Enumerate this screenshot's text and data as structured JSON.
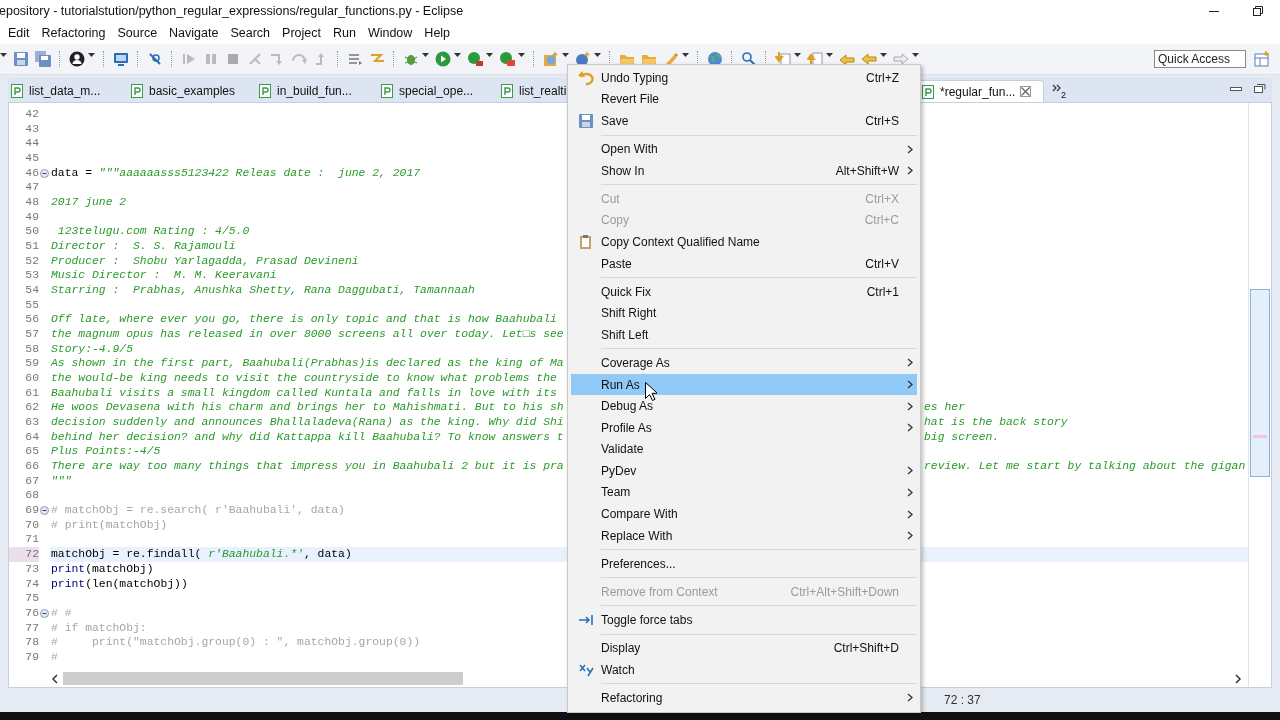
{
  "window": {
    "title": "epository - tutorialstution/python_regular_expressions/regular_functions.py - Eclipse"
  },
  "menu_bar": [
    "Edit",
    "Refactoring",
    "Source",
    "Navigate",
    "Search",
    "Project",
    "Run",
    "Window",
    "Help"
  ],
  "quick_access": {
    "placeholder": "Quick Access"
  },
  "tabs": [
    {
      "label": "list_data_m...",
      "selected": false
    },
    {
      "label": "basic_examples",
      "selected": false
    },
    {
      "label": "in_build_fun...",
      "selected": false
    },
    {
      "label": "special_ope...",
      "selected": false
    },
    {
      "label": "list_realti",
      "selected": false
    },
    {
      "label": "*regular_fun...",
      "selected": true
    }
  ],
  "tabs_overflow": "2",
  "editor": {
    "lines": [
      {
        "number": "42",
        "fold": false,
        "current": false
      },
      {
        "number": "43",
        "fold": false,
        "current": false
      },
      {
        "number": "44",
        "fold": false,
        "current": false
      },
      {
        "number": "45",
        "fold": false,
        "current": false
      },
      {
        "number": "46",
        "fold": true,
        "current": false,
        "segments": [
          {
            "kind": "code",
            "text": "data = "
          },
          {
            "kind": "string",
            "text": "\"\"\"aaaaaasss5123422 Releas date :  june 2, 2017"
          }
        ]
      },
      {
        "number": "47",
        "fold": false,
        "current": false
      },
      {
        "number": "48",
        "fold": false,
        "current": false,
        "segments": [
          {
            "kind": "string",
            "text": "2017 june 2"
          }
        ]
      },
      {
        "number": "49",
        "fold": false,
        "current": false
      },
      {
        "number": "50",
        "fold": false,
        "current": false,
        "segments": [
          {
            "kind": "string",
            "text": " 123telugu.com Rating : 4/5.0"
          }
        ]
      },
      {
        "number": "51",
        "fold": false,
        "current": false,
        "segments": [
          {
            "kind": "string",
            "text": "Director :  S. S. Rajamouli"
          }
        ]
      },
      {
        "number": "52",
        "fold": false,
        "current": false,
        "segments": [
          {
            "kind": "string",
            "text": "Producer :  Shobu Yarlagadda, Prasad Devineni"
          }
        ]
      },
      {
        "number": "53",
        "fold": false,
        "current": false,
        "segments": [
          {
            "kind": "string",
            "text": "Music Director :  M. M. Keeravani"
          }
        ]
      },
      {
        "number": "54",
        "fold": false,
        "current": false,
        "segments": [
          {
            "kind": "string",
            "text": "Starring :  Prabhas, Anushka Shetty, Rana Daggubati, Tamannaah"
          }
        ]
      },
      {
        "number": "55",
        "fold": false,
        "current": false
      },
      {
        "number": "56",
        "fold": false,
        "current": false,
        "segments": [
          {
            "kind": "string",
            "text": "Off late, where ever you go, there is only topic and that is how Baahubali"
          }
        ]
      },
      {
        "number": "57",
        "fold": false,
        "current": false,
        "segments": [
          {
            "kind": "string",
            "text": "the magnum opus has released in over 8000 screens all over today. Let□s see"
          }
        ]
      },
      {
        "number": "58",
        "fold": false,
        "current": false,
        "segments": [
          {
            "kind": "string",
            "text": "Story:-4.9/5"
          }
        ]
      },
      {
        "number": "59",
        "fold": false,
        "current": false,
        "segments": [
          {
            "kind": "string",
            "text": "As shown in the first part, Baahubali(Prabhas)is declared as the king of Ma"
          }
        ]
      },
      {
        "number": "60",
        "fold": false,
        "current": false,
        "segments": [
          {
            "kind": "string",
            "text": "the would-be king needs to visit the countryside to know what problems the"
          }
        ]
      },
      {
        "number": "61",
        "fold": false,
        "current": false,
        "segments": [
          {
            "kind": "string",
            "text": "Baahubali visits a small kingdom called Kuntala and falls in love with its"
          }
        ]
      },
      {
        "number": "62",
        "fold": false,
        "current": false,
        "segments": [
          {
            "kind": "string",
            "text": "He woos Devasena with his charm and brings her to Mahishmati. But to his sh"
          }
        ],
        "right": "es her"
      },
      {
        "number": "63",
        "fold": false,
        "current": false,
        "segments": [
          {
            "kind": "string",
            "text": "decision suddenly and announces Bhallaladeva(Rana) as the king. Why did Shi"
          }
        ],
        "right": "hat is the back story"
      },
      {
        "number": "64",
        "fold": false,
        "current": false,
        "segments": [
          {
            "kind": "string",
            "text": "behind her decision? and why did Kattappa kill Baahubali? To know answers t"
          }
        ],
        "right": "big screen."
      },
      {
        "number": "65",
        "fold": false,
        "current": false,
        "segments": [
          {
            "kind": "string",
            "text": "Plus Points:-4/5"
          }
        ]
      },
      {
        "number": "66",
        "fold": false,
        "current": false,
        "segments": [
          {
            "kind": "string",
            "text": "There are way too many things that impress you in Baahubali 2 but it is pra"
          }
        ],
        "right": "review. Let me start by talking about the gigan"
      },
      {
        "number": "67",
        "fold": false,
        "current": false,
        "segments": [
          {
            "kind": "string",
            "text": "\"\"\""
          }
        ]
      },
      {
        "number": "68",
        "fold": false,
        "current": false
      },
      {
        "number": "69",
        "fold": true,
        "current": false,
        "segments": [
          {
            "kind": "comment",
            "text": "# matchObj = re.search( r'Baahubali', data)"
          }
        ]
      },
      {
        "number": "70",
        "fold": false,
        "current": false,
        "segments": [
          {
            "kind": "comment",
            "text": "# print(matchObj)"
          }
        ]
      },
      {
        "number": "71",
        "fold": false,
        "current": false
      },
      {
        "number": "72",
        "fold": false,
        "current": true,
        "segments": [
          {
            "kind": "code",
            "text": "matchObj = re.findall( "
          },
          {
            "kind": "string",
            "text": "r'Baahubali.*'"
          },
          {
            "kind": "code",
            "text": ", data)"
          }
        ]
      },
      {
        "number": "73",
        "fold": false,
        "current": false,
        "segments": [
          {
            "kind": "builtin",
            "text": "print"
          },
          {
            "kind": "code",
            "text": "(matchObj)"
          }
        ]
      },
      {
        "number": "74",
        "fold": false,
        "current": false,
        "segments": [
          {
            "kind": "builtin",
            "text": "print"
          },
          {
            "kind": "code",
            "text": "(len(matchObj))"
          }
        ]
      },
      {
        "number": "75",
        "fold": false,
        "current": false
      },
      {
        "number": "76",
        "fold": true,
        "current": false,
        "segments": [
          {
            "kind": "comment",
            "text": "# #"
          }
        ]
      },
      {
        "number": "77",
        "fold": false,
        "current": false,
        "segments": [
          {
            "kind": "comment",
            "text": "# if matchObj:"
          }
        ]
      },
      {
        "number": "78",
        "fold": false,
        "current": false,
        "segments": [
          {
            "kind": "comment",
            "text": "#     print(\"matchObj.group(0) : \", matchObj.group(0))"
          }
        ]
      },
      {
        "number": "79",
        "fold": false,
        "current": false,
        "segments": [
          {
            "kind": "comment",
            "text": "#"
          }
        ]
      }
    ]
  },
  "status_bar": {
    "cursor_position": "72 : 37"
  },
  "context_menu": {
    "items": [
      {
        "kind": "item",
        "label": "Undo Typing",
        "shortcut": "Ctrl+Z",
        "submenu": false,
        "disabled": false,
        "selected": false
      },
      {
        "kind": "item",
        "label": "Revert File",
        "submenu": false,
        "disabled": false,
        "selected": false
      },
      {
        "kind": "item",
        "label": "Save",
        "shortcut": "Ctrl+S",
        "submenu": false,
        "disabled": false,
        "selected": false
      },
      {
        "kind": "separator"
      },
      {
        "kind": "item",
        "label": "Open With",
        "submenu": true,
        "disabled": false,
        "selected": false
      },
      {
        "kind": "item",
        "label": "Show In",
        "shortcut": "Alt+Shift+W",
        "submenu": true,
        "disabled": false,
        "selected": false
      },
      {
        "kind": "separator"
      },
      {
        "kind": "item",
        "label": "Cut",
        "shortcut": "Ctrl+X",
        "submenu": false,
        "disabled": true,
        "selected": false
      },
      {
        "kind": "item",
        "label": "Copy",
        "shortcut": "Ctrl+C",
        "submenu": false,
        "disabled": true,
        "selected": false
      },
      {
        "kind": "item",
        "label": "Copy Context Qualified Name",
        "submenu": false,
        "disabled": false,
        "selected": false
      },
      {
        "kind": "item",
        "label": "Paste",
        "shortcut": "Ctrl+V",
        "submenu": false,
        "disabled": false,
        "selected": false
      },
      {
        "kind": "separator"
      },
      {
        "kind": "item",
        "label": "Quick Fix",
        "shortcut": "Ctrl+1",
        "submenu": false,
        "disabled": false,
        "selected": false
      },
      {
        "kind": "item",
        "label": "Shift Right",
        "submenu": false,
        "disabled": false,
        "selected": false
      },
      {
        "kind": "item",
        "label": "Shift Left",
        "submenu": false,
        "disabled": false,
        "selected": false
      },
      {
        "kind": "separator"
      },
      {
        "kind": "item",
        "label": "Coverage As",
        "submenu": true,
        "disabled": false,
        "selected": false
      },
      {
        "kind": "item",
        "label": "Run As",
        "submenu": true,
        "disabled": false,
        "selected": true
      },
      {
        "kind": "item",
        "label": "Debug As",
        "submenu": true,
        "disabled": false,
        "selected": false
      },
      {
        "kind": "item",
        "label": "Profile As",
        "submenu": true,
        "disabled": false,
        "selected": false
      },
      {
        "kind": "item",
        "label": "Validate",
        "submenu": false,
        "disabled": false,
        "selected": false
      },
      {
        "kind": "item",
        "label": "PyDev",
        "submenu": true,
        "disabled": false,
        "selected": false
      },
      {
        "kind": "item",
        "label": "Team",
        "submenu": true,
        "disabled": false,
        "selected": false
      },
      {
        "kind": "item",
        "label": "Compare With",
        "submenu": true,
        "disabled": false,
        "selected": false
      },
      {
        "kind": "item",
        "label": "Replace With",
        "submenu": true,
        "disabled": false,
        "selected": false
      },
      {
        "kind": "separator"
      },
      {
        "kind": "item",
        "label": "Preferences...",
        "submenu": false,
        "disabled": false,
        "selected": false
      },
      {
        "kind": "separator"
      },
      {
        "kind": "item",
        "label": "Remove from Context",
        "shortcut": "Ctrl+Alt+Shift+Down",
        "submenu": false,
        "disabled": true,
        "selected": false
      },
      {
        "kind": "separator"
      },
      {
        "kind": "item",
        "label": "Toggle force tabs",
        "submenu": false,
        "disabled": false,
        "selected": false
      },
      {
        "kind": "separator"
      },
      {
        "kind": "item",
        "label": "Display",
        "shortcut": "Ctrl+Shift+D",
        "submenu": false,
        "disabled": false,
        "selected": false
      },
      {
        "kind": "item",
        "label": "Watch",
        "submenu": false,
        "disabled": false,
        "selected": false
      },
      {
        "kind": "separator"
      },
      {
        "kind": "item",
        "label": "Refactoring",
        "submenu": true,
        "disabled": false,
        "selected": false
      }
    ]
  }
}
